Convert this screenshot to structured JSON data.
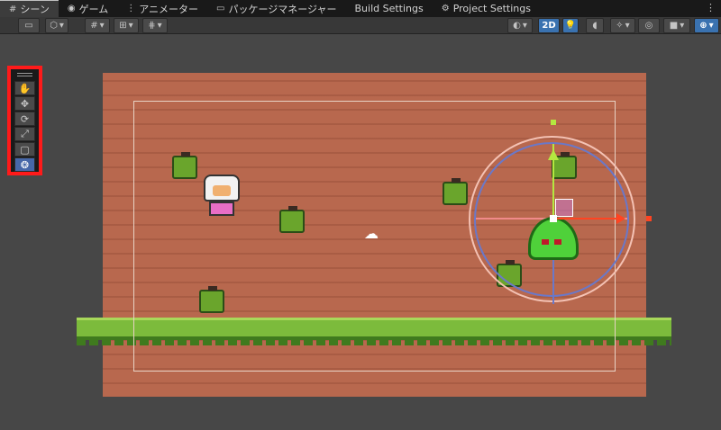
{
  "tabs": [
    {
      "label": "シーン",
      "icon": "grid-icon",
      "active": true
    },
    {
      "label": "ゲーム",
      "icon": "gamepad-icon",
      "active": false
    },
    {
      "label": "アニメーター",
      "icon": "animator-icon",
      "active": false
    },
    {
      "label": "パッケージマネージャー",
      "icon": "package-icon",
      "active": false
    },
    {
      "label": "Build Settings",
      "icon": "",
      "active": false
    },
    {
      "label": "Project Settings",
      "icon": "gear-icon",
      "active": false
    }
  ],
  "toolbar": {
    "mode_2d_label": "2D"
  },
  "tools": [
    {
      "name": "hand-tool",
      "glyph": "✋"
    },
    {
      "name": "move-tool",
      "glyph": "✥"
    },
    {
      "name": "rotate-tool",
      "glyph": "⟳"
    },
    {
      "name": "scale-tool",
      "glyph": "⤢"
    },
    {
      "name": "rect-tool",
      "glyph": "▢"
    },
    {
      "name": "transform-tool",
      "glyph": "❂",
      "active": true
    }
  ],
  "colors": {
    "accent": "#3a72b0",
    "highlight_box": "#ff1a1a",
    "ground": "#b8684e",
    "grass": "#7cbb3c"
  }
}
